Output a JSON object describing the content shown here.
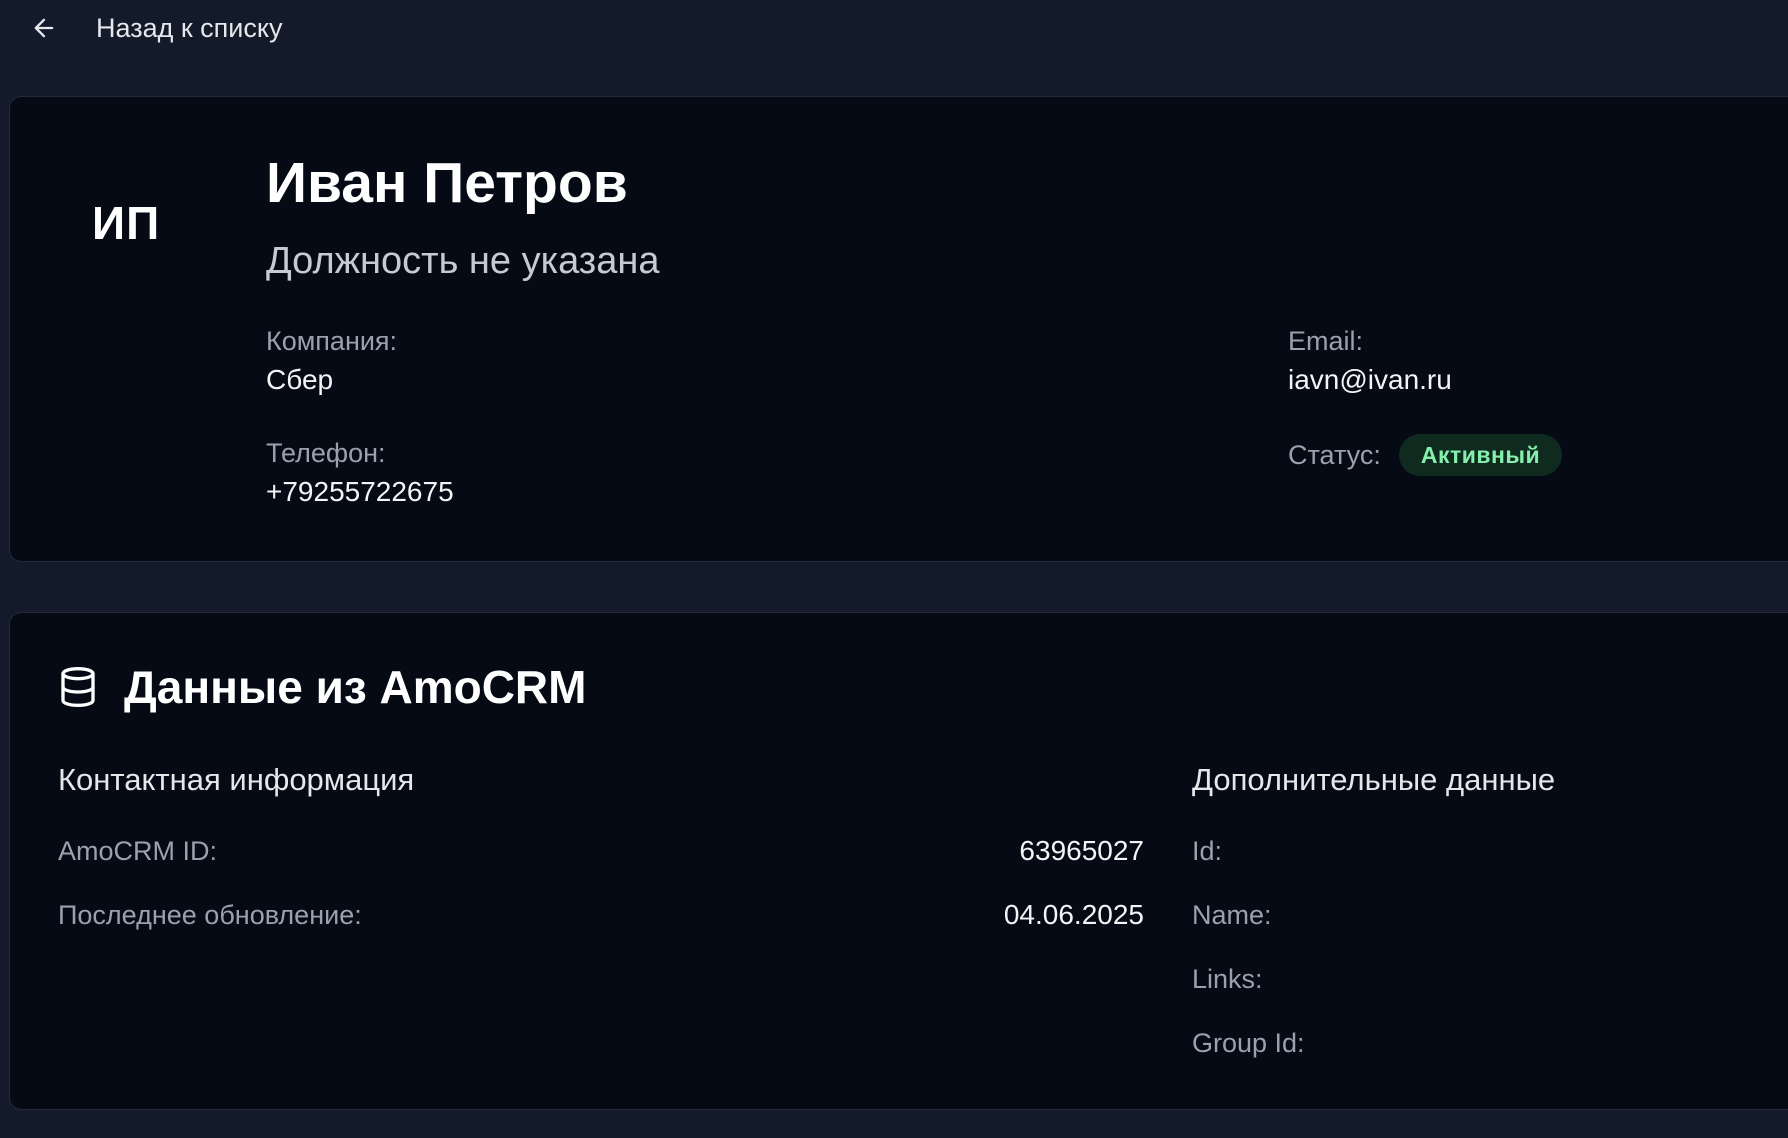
{
  "nav": {
    "back_label": "Назад к списку"
  },
  "contact": {
    "initials": "ИП",
    "name": "Иван Петров",
    "position": "Должность не указана",
    "company_label": "Компания:",
    "company": "Сбер",
    "phone_label": "Телефон:",
    "phone": "+79255722675",
    "email_label": "Email:",
    "email": "iavn@ivan.ru",
    "status_label": "Статус:",
    "status": "Активный",
    "status_color": "#86efac"
  },
  "crm": {
    "icon": "database-icon",
    "title": "Данные из AmoCRM",
    "contact_info": {
      "title": "Контактная информация",
      "rows": [
        {
          "label": "AmoCRM ID:",
          "value": "63965027"
        },
        {
          "label": "Последнее обновление:",
          "value": "04.06.2025"
        }
      ]
    },
    "extra": {
      "title": "Дополнительные данные",
      "rows": [
        {
          "label": "Id:",
          "value": ""
        },
        {
          "label": "Name:",
          "value": ""
        },
        {
          "label": "Links:",
          "value": ""
        },
        {
          "label": "Group Id:",
          "value": ""
        }
      ]
    }
  }
}
